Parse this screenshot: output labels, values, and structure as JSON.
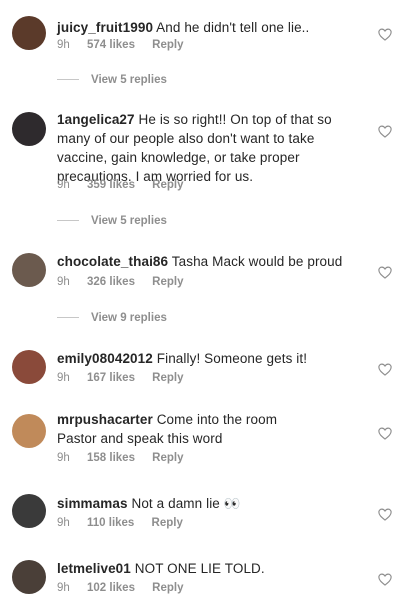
{
  "comments": [
    {
      "username": "juicy_fruit1990",
      "text": "And he didn't tell one lie..",
      "time": "9h",
      "likes": "574 likes",
      "reply": "Reply",
      "view_replies": "View 5 replies",
      "avatar_color": "#5b3a2a"
    },
    {
      "username": "1angelica27",
      "text": "He is so right!! On top of that so many of our people also don't want to take vaccine, gain knowledge, or take proper precautions. I am worried for us.",
      "time": "9h",
      "likes": "359 likes",
      "reply": "Reply",
      "view_replies": "View 5 replies",
      "avatar_color": "#2e2a2d"
    },
    {
      "username": "chocolate_thai86",
      "text": "Tasha Mack would be proud",
      "time": "9h",
      "likes": "326 likes",
      "reply": "Reply",
      "view_replies": "View 9 replies",
      "avatar_color": "#6b5a4e"
    },
    {
      "username": "emily08042012",
      "text": "Finally! Someone gets it!",
      "time": "9h",
      "likes": "167 likes",
      "reply": "Reply",
      "avatar_color": "#8a4a3a"
    },
    {
      "username": "mrpushacarter",
      "text": "Come into the room Pastor and speak this word",
      "time": "9h",
      "likes": "158 likes",
      "reply": "Reply",
      "avatar_color": "#c08a5a"
    },
    {
      "username": "simmamas",
      "text": "Not a damn lie 👀",
      "time": "9h",
      "likes": "110 likes",
      "reply": "Reply",
      "avatar_color": "#3a3a3a"
    },
    {
      "username": "letmelive01",
      "text": "NOT ONE LIE TOLD.",
      "time": "9h",
      "likes": "102 likes",
      "reply": "Reply",
      "avatar_color": "#4a3f38"
    }
  ],
  "colors": {
    "username": "#262626",
    "meta": "#8e8e8e",
    "heart": "#8e8e8e"
  },
  "icons": {
    "like": "heart-outline-icon"
  }
}
